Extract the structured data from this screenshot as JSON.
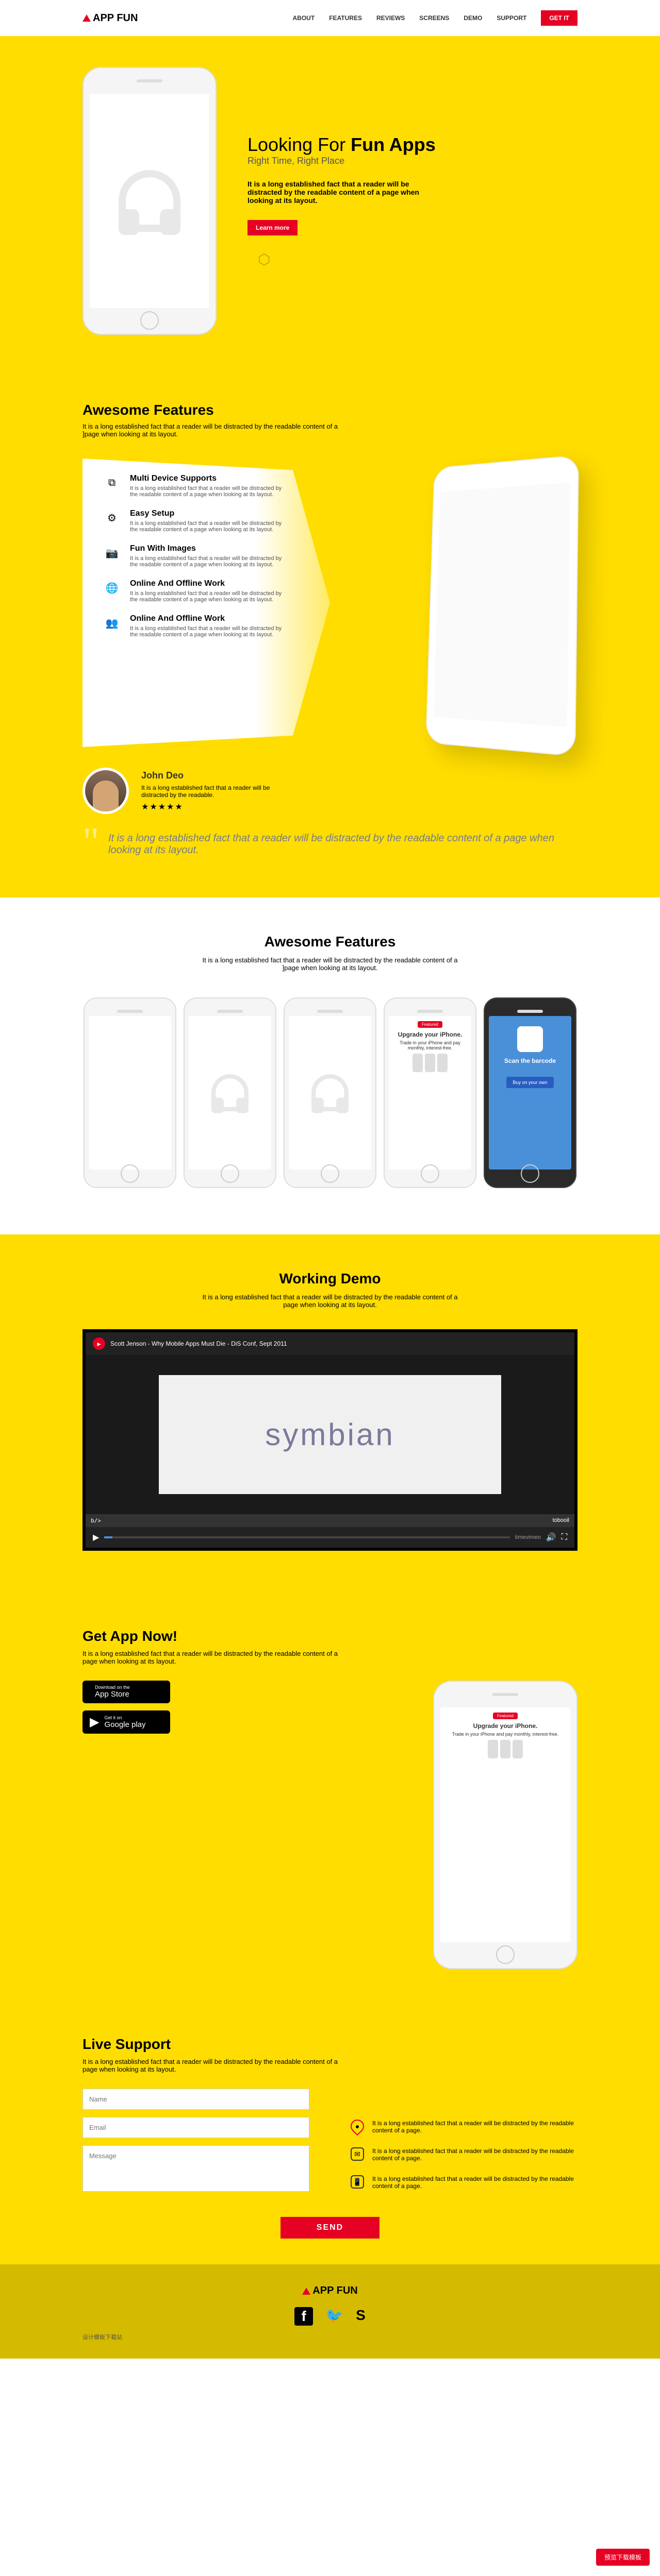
{
  "brand": {
    "name1": "APP",
    "name2": "FUN"
  },
  "nav": {
    "about": "ABOUT",
    "features": "FEATURES",
    "reviews": "REVIEWS",
    "screens": "SCREENS",
    "demo": "DEMO",
    "support": "SUPPORT",
    "getit": "GET IT"
  },
  "hero": {
    "h1_a": "Looking For ",
    "h1_b": "Fun Apps",
    "subtitle": "Right Time, Right Place",
    "desc": "It is a long established fact that a reader will be distracted by the readable content of a page when looking at its layout.",
    "cta": "Learn more"
  },
  "feat": {
    "title": "Awesome Features",
    "desc": "It is a long established fact that a reader will be distracted by the readable content of a ]page when looking at its layout.",
    "items": [
      {
        "title": "Multi Device Supports",
        "body": "It is a long established fact that a reader will be distracted by the readable content of a page when looking at its layout."
      },
      {
        "title": "Easy Setup",
        "body": "It is a long established fact that a reader will be distracted by the readable content of a page when looking at its layout."
      },
      {
        "title": "Fun With Images",
        "body": "It is a long established fact that a reader will be distracted by the readable content of a page when looking at its layout."
      },
      {
        "title": "Online And Offline Work",
        "body": "It is a long established fact that a reader will be distracted by the readable content of a page when looking at its layout."
      },
      {
        "title": "Online And Offline Work",
        "body": "It is a long established fact that a reader will be distracted by the readable content of a page when looking at its layout."
      }
    ]
  },
  "testi": {
    "name": "John Deo",
    "line": "It is a long established fact that a reader will be distracted by the readable.",
    "stars": "★★★★★",
    "quote": "It is a long established fact that a reader will be distracted by the readable content of a page when looking at its layout."
  },
  "gallery": {
    "title": "Awesome Features",
    "desc": "It is a long established fact that a reader will be distracted by the readable content of a ]page when looking at its layout.",
    "upgrade_badge": "Featured",
    "upgrade_h": "Upgrade your iPhone.",
    "upgrade_p": "Trade in your iPhone and pay monthly, interest-free.",
    "scan_t": "Scan the barcode",
    "scan_b": "Buy on your own"
  },
  "demo": {
    "title": "Working Demo",
    "desc": "It is a long established fact that a reader will be distracted by the readable content of a page when looking at its layout.",
    "vid_label": "Scott Jenson - Why Mobile Apps Must Die - DiS Conf, Sept 2011",
    "vid_word": "symbian",
    "vid_brand": "tobooil",
    "vid_src": "timevimeo"
  },
  "getapp": {
    "title": "Get App Now!",
    "desc": "It is a long established fact that a reader will be distracted by the readable content of a page when looking at its layout.",
    "appstore_s": "Download on the",
    "appstore_b": "App Store",
    "play_s": "Get it on",
    "play_b": "Google play",
    "upgrade_h": "Upgrade your iPhone.",
    "upgrade_p": "Trade in your iPhone and pay monthly, interest-free."
  },
  "support": {
    "title": "Live Support",
    "desc": "It is a long established fact that a reader will be distracted by the readable content of a page when looking at its layout.",
    "ph_name": "Name",
    "ph_email": "Email",
    "ph_msg": "Message",
    "info1": "It is a long established fact that a reader will be distracted by the readable content of a page.",
    "info2": "It is a long established fact that a reader will be distracted by the readable content of a page.",
    "info3": "It is a long established fact that a reader will be distracted by the readable content of a page.",
    "send": "SEND"
  },
  "footer": {
    "copy": "设计模板下载站",
    "dl": "预览下载模板"
  }
}
